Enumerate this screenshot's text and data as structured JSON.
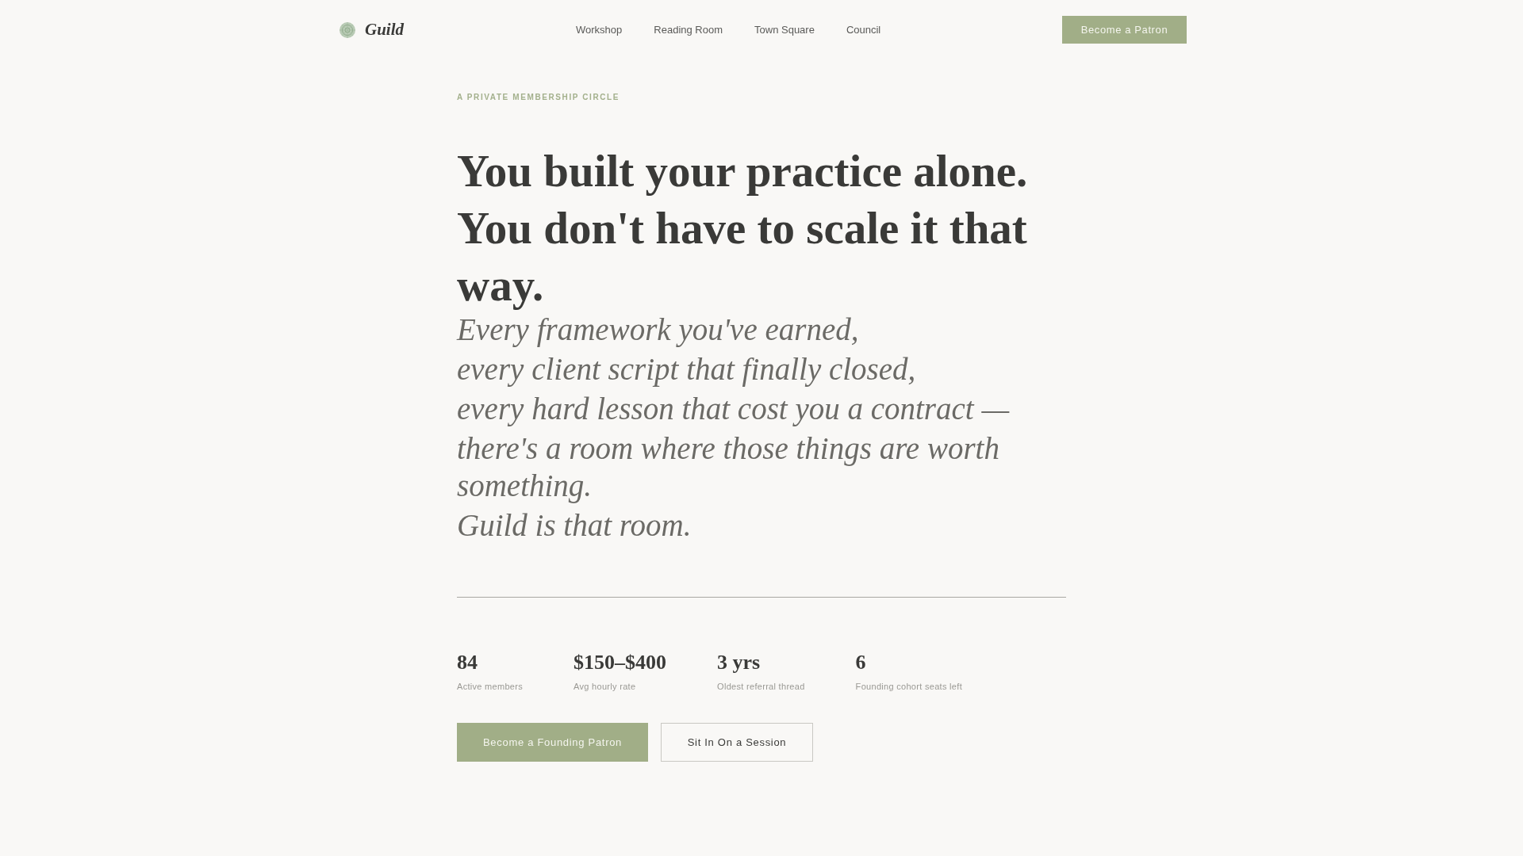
{
  "brand": {
    "name": "Guild"
  },
  "nav": [
    {
      "label": "Workshop"
    },
    {
      "label": "Reading Room"
    },
    {
      "label": "Town Square"
    },
    {
      "label": "Council"
    }
  ],
  "header_button": "Become a Patron",
  "eyebrow": "A PRIVATE MEMBERSHIP CIRCLE",
  "headline": [
    "You built your practice alone.",
    "You don't have to scale it that way."
  ],
  "poem": [
    "Every framework you've earned,",
    "every client script that finally closed,",
    "every hard lesson that cost you a contract —",
    "there's a room where those things are worth something.",
    "Guild is that room."
  ],
  "stats": [
    {
      "value": "84",
      "label": "Active members"
    },
    {
      "value": "$150–$400",
      "label": "Avg hourly rate"
    },
    {
      "value": "3 yrs",
      "label": "Oldest referral thread"
    },
    {
      "value": "6",
      "label": "Founding cohort seats left"
    }
  ],
  "actions": [
    {
      "label": "Become a Founding Patron",
      "kind": "primary"
    },
    {
      "label": "Sit In On a Session",
      "kind": "secondary"
    }
  ]
}
